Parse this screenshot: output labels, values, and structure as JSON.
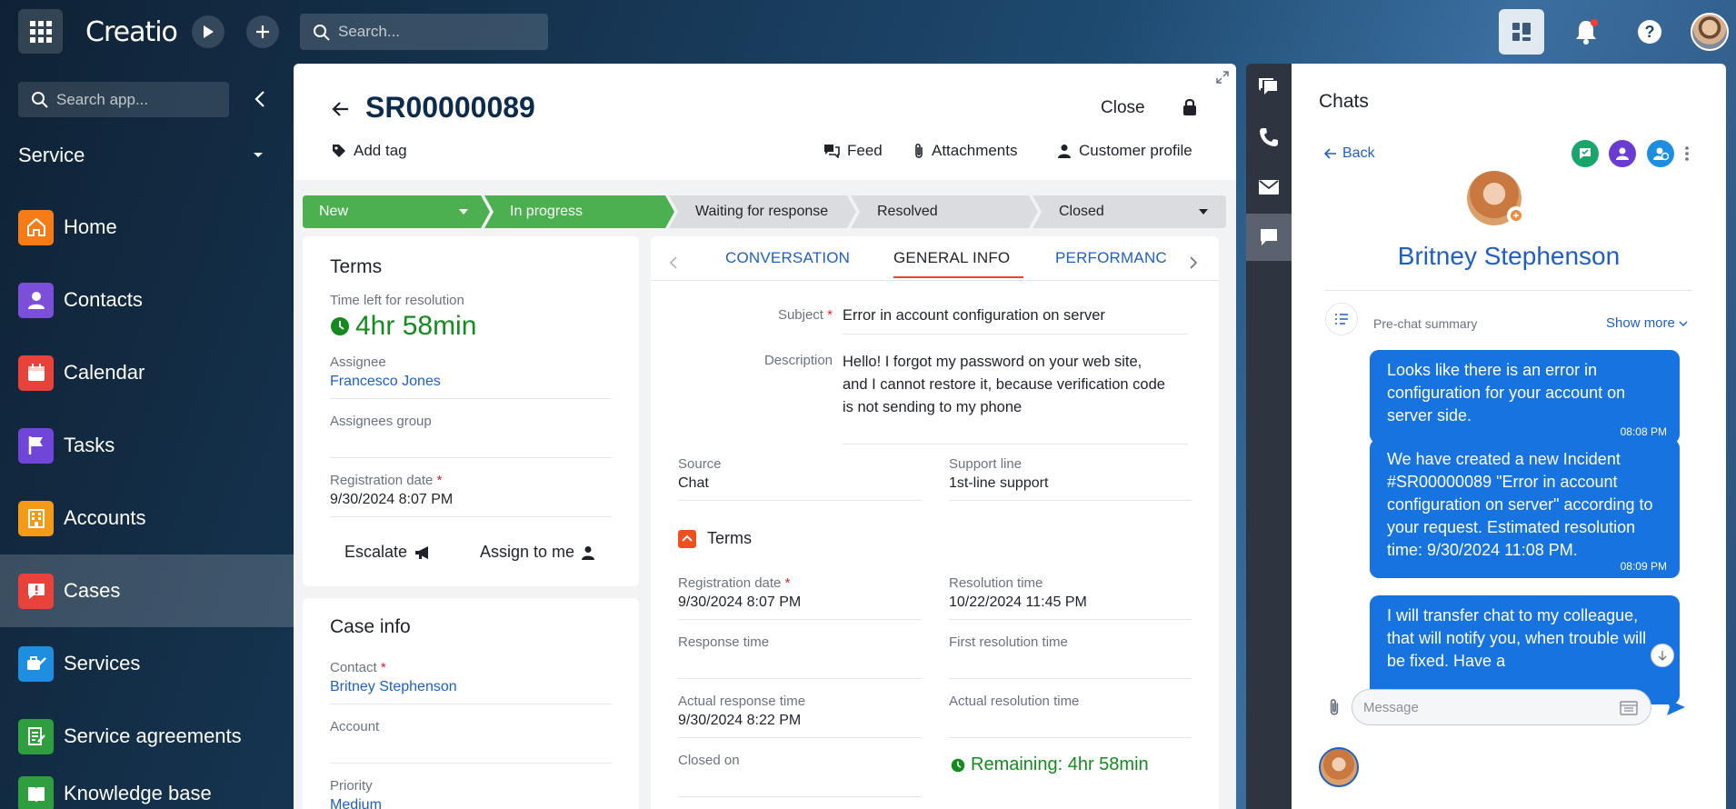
{
  "topbar": {
    "logo": "Creatio",
    "search_placeholder": "Search..."
  },
  "sidebar": {
    "search_placeholder": "Search app...",
    "workplace": "Service",
    "items": [
      {
        "label": "Home",
        "color": "#f57c16"
      },
      {
        "label": "Contacts",
        "color": "#7b4fd9"
      },
      {
        "label": "Calendar",
        "color": "#e9423a"
      },
      {
        "label": "Tasks",
        "color": "#7046d8"
      },
      {
        "label": "Accounts",
        "color": "#f59a16"
      },
      {
        "label": "Cases",
        "color": "#e9423a"
      },
      {
        "label": "Services",
        "color": "#1e8fe0"
      },
      {
        "label": "Service agreements",
        "color": "#2e9e3e"
      },
      {
        "label": "Knowledge base",
        "color": "#2e9e3e"
      }
    ]
  },
  "header": {
    "title": "SR00000089",
    "close_label": "Close",
    "add_tag": "Add tag",
    "feed": "Feed",
    "attachments": "Attachments",
    "customer_profile": "Customer profile"
  },
  "stages": [
    "New",
    "In progress",
    "Waiting for response",
    "Resolved",
    "Closed"
  ],
  "terms_card": {
    "title": "Terms",
    "time_left_label": "Time left for resolution",
    "time_left_value": "4hr 58min",
    "assignee_label": "Assignee",
    "assignee_value": "Francesco Jones",
    "assignees_group_label": "Assignees group",
    "registration_date_label": "Registration date",
    "registration_date_value": "9/30/2024 8:07 PM",
    "escalate": "Escalate",
    "assign_to_me": "Assign to me"
  },
  "case_info": {
    "title": "Case info",
    "contact_label": "Contact",
    "contact_value": "Britney Stephenson",
    "account_label": "Account",
    "priority_label": "Priority",
    "priority_value": "Medium"
  },
  "tabs": {
    "items": [
      "CONVERSATION",
      "GENERAL INFO",
      "PERFORMANC"
    ],
    "subject_label": "Subject",
    "subject_value": "Error in account configuration on server",
    "description_label": "Description",
    "description_value": "Hello! I forgot my password on your web site, and I cannot restore it, because verification code is not sending to my phone",
    "source_label": "Source",
    "source_value": "Chat",
    "support_line_label": "Support line",
    "support_line_value": "1st-line support",
    "terms_title": "Terms",
    "reg_date_label": "Registration date",
    "reg_date_value": "9/30/2024 8:07 PM",
    "resolution_time_label": "Resolution time",
    "resolution_time_value": "10/22/2024 11:45 PM",
    "response_time_label": "Response time",
    "first_resolution_label": "First resolution time",
    "actual_response_label": "Actual response time",
    "actual_response_value": "9/30/2024 8:22 PM",
    "actual_resolution_label": "Actual resolution time",
    "closed_on_label": "Closed on",
    "remaining": "Remaining: 4hr 58min"
  },
  "chat": {
    "title": "Chats",
    "back": "Back",
    "contact_name": "Britney Stephenson",
    "prechat_label": "Pre-chat summary",
    "show_more": "Show more",
    "message_placeholder": "Message",
    "messages": [
      {
        "text": "Looks like there is an error in configuration for your account on server side.",
        "time": "08:08 PM"
      },
      {
        "text": "We have created a new Incident #SR00000089 \"Error in account configuration on server\" according to your request. Estimated resolution time: 9/30/2024 11:08 PM.",
        "time": "08:09 PM"
      },
      {
        "text": "I will transfer chat to my colleague, that will notify you, when trouble will be fixed. Have a",
        "time": ""
      }
    ]
  }
}
